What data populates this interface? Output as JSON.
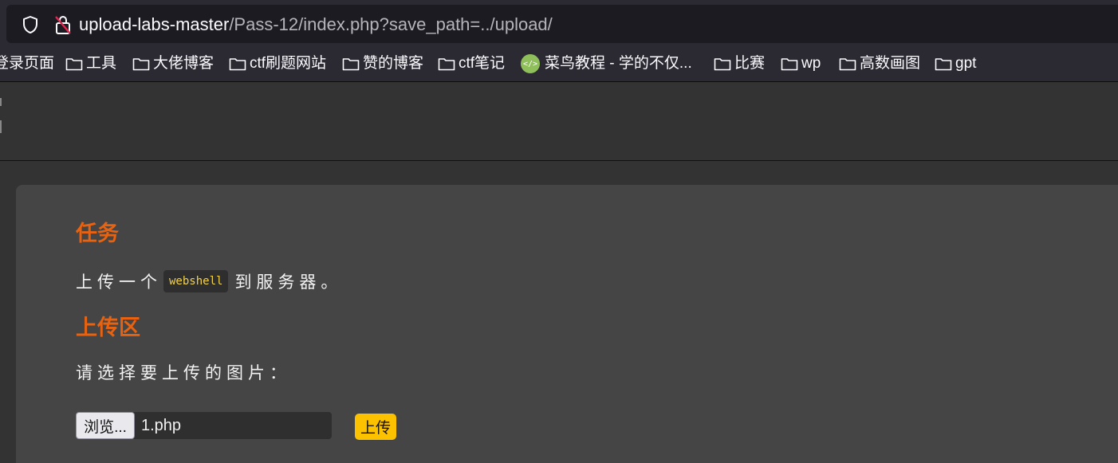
{
  "urlbar": {
    "host": "upload-labs-master",
    "path": "/Pass-12/index.php?save_path=../upload/"
  },
  "bookmarks": [
    {
      "label": "登录页面",
      "icon": "none"
    },
    {
      "label": "工具",
      "icon": "folder-icon"
    },
    {
      "label": "大佬博客",
      "icon": "folder-icon"
    },
    {
      "label": "ctf刷题网站",
      "icon": "folder-icon"
    },
    {
      "label": "赞的博客",
      "icon": "folder-icon"
    },
    {
      "label": "ctf笔记",
      "icon": "folder-icon"
    },
    {
      "label": "菜鸟教程 - 学的不仅...",
      "icon": "runoob-favicon"
    },
    {
      "label": "比赛",
      "icon": "folder-icon"
    },
    {
      "label": "wp",
      "icon": "folder-icon"
    },
    {
      "label": "高数画图",
      "icon": "folder-icon"
    },
    {
      "label": "gpt",
      "icon": "folder-icon"
    }
  ],
  "task": {
    "heading": "任务",
    "text_before": "上传一个",
    "code": "webshell",
    "text_after": "到服务器。"
  },
  "upload": {
    "heading": "上传区",
    "prompt": "请选择要上传的图片：",
    "browse_label": "浏览...",
    "file_name": "1.php",
    "submit_label": "上传"
  },
  "colors": {
    "heading": "#e8620f",
    "submit_bg": "#fcc200",
    "code_text": "#f2d24b"
  }
}
